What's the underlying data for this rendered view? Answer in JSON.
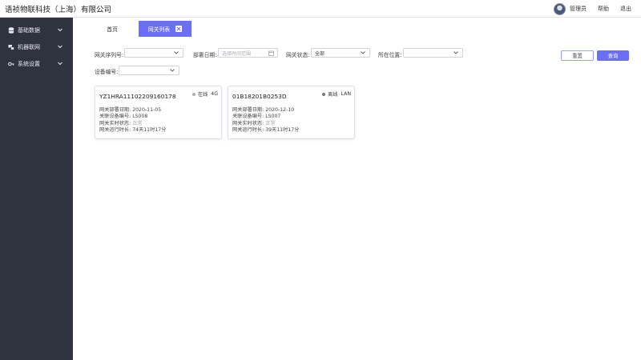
{
  "app": {
    "title": "语祯物联科技（上海）有限公司"
  },
  "topbar": {
    "user_name": "管理员",
    "help_label": "帮助",
    "logout_label": "退出"
  },
  "sidebar": {
    "items": [
      {
        "label": "基础数据",
        "icon": "database-icon"
      },
      {
        "label": "机器联网",
        "icon": "network-icon"
      },
      {
        "label": "系统设置",
        "icon": "key-icon"
      }
    ]
  },
  "tabs": {
    "home_label": "首页",
    "active_label": "网关列表"
  },
  "filters": {
    "serial_label": "网关序列号:",
    "serial_value": "",
    "date_label": "部署日期:",
    "date_placeholder": "选择时间范围",
    "status_label": "网关状态:",
    "status_value": "全部",
    "location_label": "所在位置:",
    "location_value": "",
    "device_label": "设备编号:",
    "device_value": ""
  },
  "buttons": {
    "reset_label": "重置",
    "search_label": "查询"
  },
  "cards": [
    {
      "serial": "YZ1HRA11102209160178",
      "status": "在线",
      "status_color": "#b0b0b0",
      "network": "4G",
      "deploy_label": "网关部署日期:",
      "deploy_value": "2020-11-05",
      "device_label": "关联设备编号:",
      "device_value": "LS008",
      "realtime_label": "网关实时状态:",
      "realtime_value": "正常",
      "uptime_label": "网关运行时长:",
      "uptime_value": "74天11时17分"
    },
    {
      "serial": "01B18201B0253D",
      "status": "离线",
      "status_color": "#777777",
      "network": "LAN",
      "deploy_label": "网关部署日期:",
      "deploy_value": "2020-12-10",
      "device_label": "关联设备编号:",
      "device_value": "LS007",
      "realtime_label": "网关实时状态:",
      "realtime_value": "正常",
      "uptime_label": "网关运行时长:",
      "uptime_value": "39天11时17分"
    }
  ],
  "colors": {
    "accent": "#6b6ff5",
    "sidebar": "#2f3340"
  }
}
